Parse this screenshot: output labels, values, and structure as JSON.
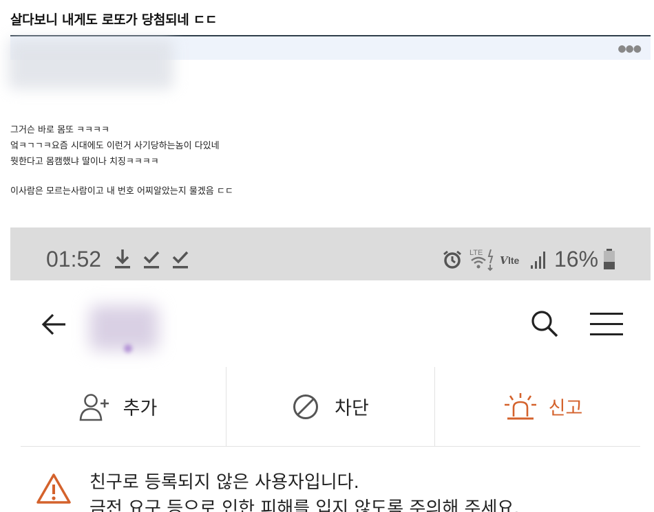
{
  "post": {
    "title": "살다보니 내게도 로또가 당첨되네 ㄷㄷ",
    "body": [
      "그거슨 바로 몸또 ㅋㅋㅋㅋ",
      "엌ㅋㄱㄱㅋ요즘 시대에도 이런거 사기당하는놈이 다있네",
      "뭣한다고 몸캠했냐 딸이나 치징ㅋㅋㅋㅋ",
      " 이사람은 모르는사람이고 내 번호 어찌알았는지 물겠음 ㄷㄷ"
    ]
  },
  "phone": {
    "time": "01:52",
    "battery": "16%",
    "actions": {
      "add": "추가",
      "block": "차단",
      "report": "신고"
    },
    "warning": [
      "친구로 등록되지 않은 사용자입니다.",
      "금전 요구 등으로 인한 피해를 입지 않도록 주의해 주세요."
    ]
  },
  "colors": {
    "accent": "#d4622c",
    "title_rule": "#2e3d4a",
    "meta_bar": "#eef3fb",
    "statusbar": "#dcdcdc"
  }
}
